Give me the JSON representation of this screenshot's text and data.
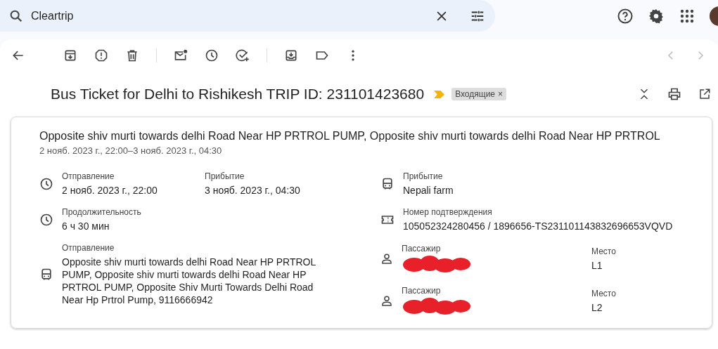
{
  "search": {
    "value": "Cleartrip"
  },
  "subject": "Bus Ticket for Delhi to Rishikesh TRIP ID: 231101423680",
  "label_chip": {
    "text": "Входящие",
    "close": "×"
  },
  "card": {
    "title": "Opposite shiv murti towards delhi Road Near HP PRTROL PUMP, Opposite shiv murti towards delhi Road Near HP PRTROL",
    "dates": "2 нояб. 2023 г., 22:00–3 нояб. 2023 г., 04:30",
    "left": [
      {
        "kind": "time",
        "fields": [
          {
            "label": "Отправление",
            "value": "2 нояб. 2023 г., 22:00"
          },
          {
            "label": "Прибытие",
            "value": "3 нояб. 2023 г., 04:30"
          }
        ]
      },
      {
        "kind": "time",
        "fields": [
          {
            "label": "Продолжительность",
            "value": "6 ч 30 мин"
          }
        ]
      },
      {
        "kind": "place",
        "fields": [
          {
            "label": "Отправление",
            "value": "Opposite shiv murti towards delhi Road Near HP PRTROL PUMP, Opposite shiv murti towards delhi Road Near HP PRTROL PUMP, Opposite Shiv Murti Towards Delhi Road Near Hp Prtrol Pump, 9116666942"
          }
        ]
      }
    ],
    "right": [
      {
        "kind": "place",
        "fields": [
          {
            "label": "Прибытие",
            "value": "Nepali farm"
          }
        ]
      },
      {
        "kind": "booking",
        "fields": [
          {
            "label": "Номер подтверждения",
            "value": "105052324280456 / 1896656-TS231101143832696653VQVD"
          }
        ]
      }
    ],
    "passengers": [
      {
        "label": "Пассажир",
        "seat_label": "Место",
        "seat": "L1"
      },
      {
        "label": "Пассажир",
        "seat_label": "Место",
        "seat": "L2"
      }
    ]
  }
}
